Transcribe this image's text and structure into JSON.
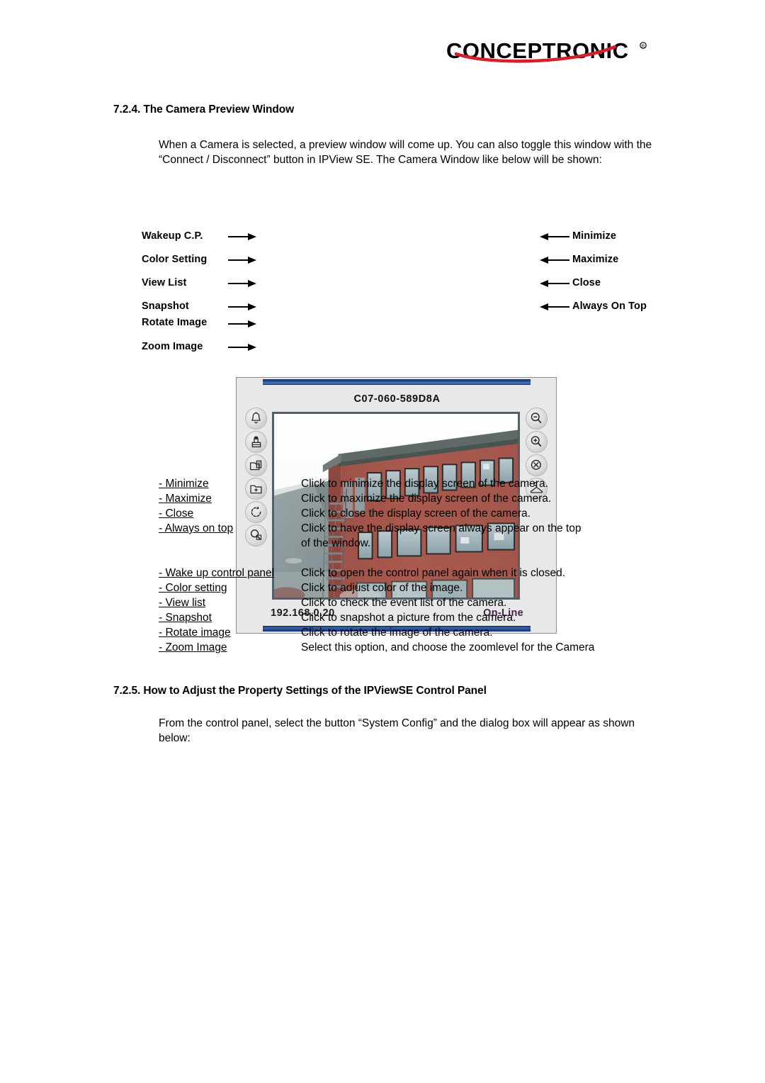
{
  "brand": {
    "logo_text": "CONCEPTRONIC",
    "logo_trademark": "®"
  },
  "sections": {
    "camera_preview": {
      "heading": "7.2.4. The Camera Preview Window",
      "paragraph": "When a Camera is selected, a preview window will come up. You can also toggle this window with the “Connect / Disconnect” button in IPView SE. The Camera Window like below will be shown:"
    },
    "property_settings": {
      "heading": "7.2.5. How to Adjust the Property Settings of the IPViewSE Control Panel",
      "paragraph": "From the control panel, select the button “System Config” and the dialog box will appear as shown below:"
    }
  },
  "camera_window": {
    "title": "C07-060-589D8A",
    "ip_address": "192.168.0.20",
    "status": "On-Line",
    "status_color": "#4b2050",
    "titlebar_color": "#23488f",
    "panel_color": "#e8e8e8",
    "video_border_color": "#50616a",
    "left_buttons": [
      {
        "icon": "bell-icon",
        "label": "Wakeup C.P."
      },
      {
        "icon": "color-setting-icon",
        "label": "Color Setting"
      },
      {
        "icon": "view-list-icon",
        "label": "View List"
      },
      {
        "icon": "snapshot-icon",
        "label": "Snapshot"
      },
      {
        "icon": "rotate-icon",
        "label": "Rotate Image"
      },
      {
        "icon": "zoom-magnifier-icon",
        "label": "Zoom Image"
      }
    ],
    "right_buttons": [
      {
        "icon": "zoom-out-icon",
        "label": "Minimize"
      },
      {
        "icon": "zoom-in-icon",
        "label": "Maximize"
      },
      {
        "icon": "close-circle-icon",
        "label": "Close"
      },
      {
        "icon": "hanger-icon",
        "label": "Always On Top"
      }
    ]
  },
  "definitions": [
    {
      "term": "- Minimize",
      "desc": "Click to minimize the display screen of the camera."
    },
    {
      "term": "- Maximize",
      "desc": "Click to maximize the display screen of the camera."
    },
    {
      "term": "- Close",
      "desc": "Click to close the display screen of the camera."
    },
    {
      "term": "- Always on top",
      "desc": "Click to have the display screen always appear on the top",
      "desc2": "of the window."
    },
    {
      "term": "- Wake up control panel",
      "desc": "Click to open the control panel again when it is closed."
    },
    {
      "term": "- Color setting",
      "desc": "Click to adjust color of the image."
    },
    {
      "term": "- View list",
      "desc": "Click to check the event list of the camera."
    },
    {
      "term": "- Snapshot",
      "desc": "Click to snapshot a picture from the camera."
    },
    {
      "term": "- Rotate image",
      "desc": "Click to rotate the image of the camera."
    },
    {
      "term": "- Zoom Image",
      "desc": "Select this option, and choose the zoomlevel for the Camera"
    }
  ]
}
